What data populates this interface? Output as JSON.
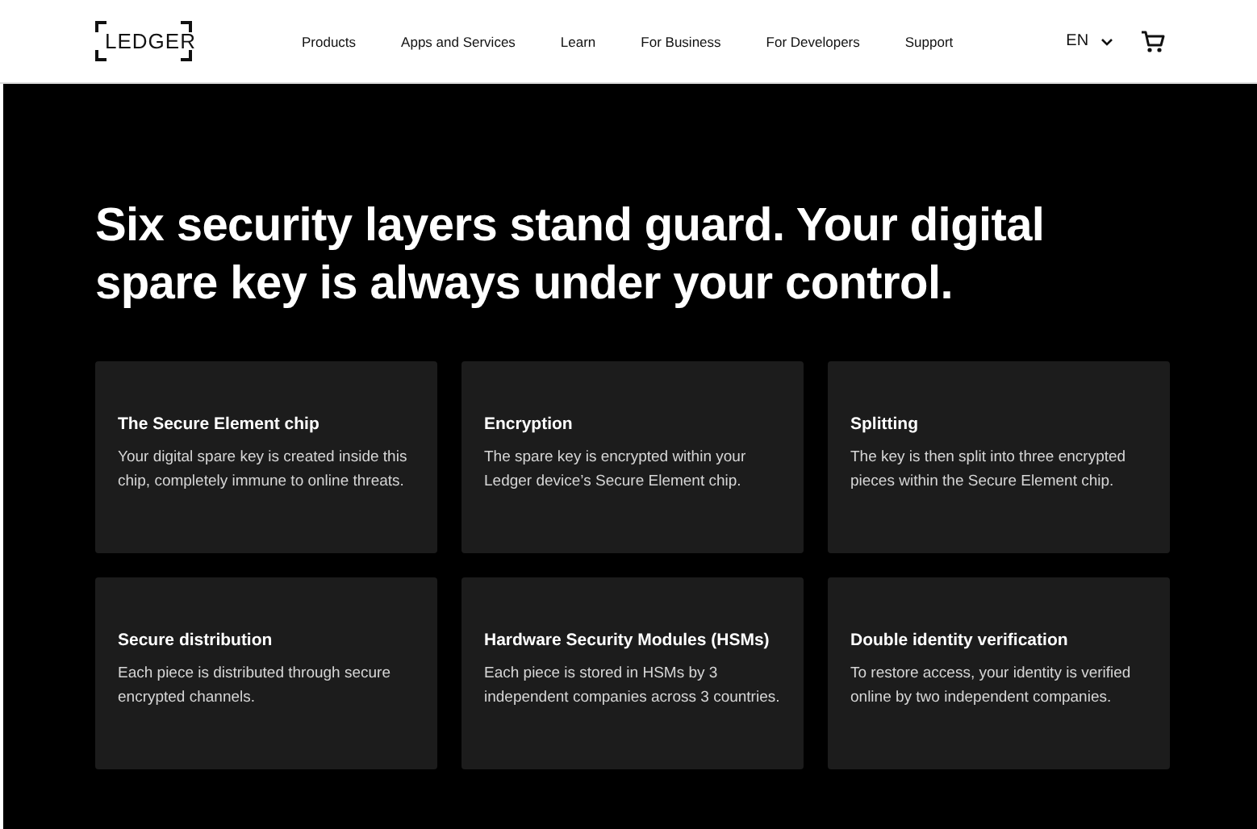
{
  "header": {
    "logo": "LEDGER",
    "nav": [
      "Products",
      "Apps and Services",
      "Learn",
      "For Business",
      "For Developers",
      "Support"
    ],
    "language": "EN"
  },
  "headline": "Six security layers stand guard. Your digital spare key is always under your control.",
  "cards": [
    {
      "title": "The Secure Element chip",
      "text": "Your digital spare key is created inside this chip, completely immune to online threats."
    },
    {
      "title": "Encryption",
      "text": "The spare key is encrypted within your Ledger device’s Secure Element chip."
    },
    {
      "title": "Splitting",
      "text": "The key is then split into three encrypted pieces within the Secure Element chip."
    },
    {
      "title": "Secure distribution",
      "text": "Each piece is distributed through secure encrypted channels."
    },
    {
      "title": "Hardware Security Modules (HSMs)",
      "text": "Each piece is stored in HSMs by 3 independent companies across 3 countries."
    },
    {
      "title": "Double identity verification",
      "text": "To restore access, your identity is verified online by two independent companies."
    }
  ]
}
